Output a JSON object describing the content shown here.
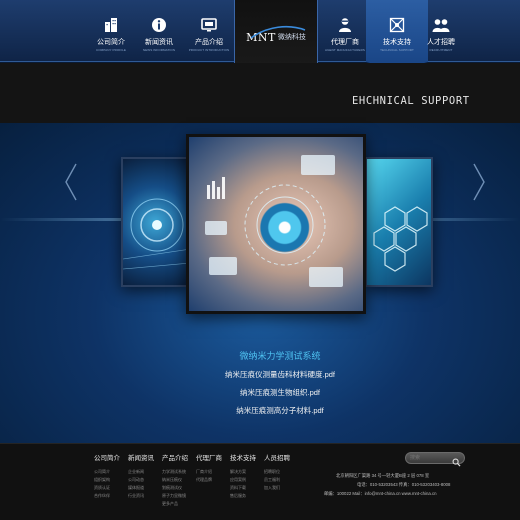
{
  "nav": {
    "items": [
      {
        "label": "公司简介",
        "sub": "COMPANY PROFILE",
        "icon": "building-icon"
      },
      {
        "label": "新闻资讯",
        "sub": "NEWS INFORMATION",
        "icon": "info-icon"
      },
      {
        "label": "产品介绍",
        "sub": "PRODUCT INTRODUCTION",
        "icon": "monitor-icon"
      },
      {
        "label": "代理厂商",
        "sub": "AGENT MANUFACTURERS",
        "icon": "agent-icon"
      },
      {
        "label": "技术支持",
        "sub": "TECHNICAL SUPPORT",
        "icon": "network-icon"
      },
      {
        "label": "人才招聘",
        "sub": "RECRUITMENT",
        "icon": "people-icon"
      }
    ],
    "active_index": 4
  },
  "logo": {
    "text": "MNT",
    "cn": "微纳科技"
  },
  "section_title": "EHCHNICAL SUPPORT",
  "gallery": {
    "caption_title": "微纳米力学测试系统",
    "files": [
      "纳米压痕仪测量齿科材料硬度.pdf",
      "纳米压痕测生物组织.pdf",
      "纳米压痕测高分子材料.pdf"
    ]
  },
  "footer": {
    "columns": [
      {
        "title": "公司简介",
        "links": [
          "公司简介",
          "组织架构",
          "资质认证",
          "合作伙伴"
        ]
      },
      {
        "title": "新闻资讯",
        "links": [
          "企业新闻",
          "公司动态",
          "媒体报道",
          "行业资讯"
        ]
      },
      {
        "title": "产品介绍",
        "links": [
          "力学测试系统",
          "纳米压痕仪",
          "划痕测试仪",
          "原子力显微镜",
          "更多产品"
        ]
      },
      {
        "title": "代理厂商",
        "links": [
          "厂商介绍",
          "代理品牌"
        ]
      },
      {
        "title": "技术支持",
        "links": [
          "解决方案",
          "应用案例",
          "资料下载",
          "售后服务"
        ]
      },
      {
        "title": "人员招聘",
        "links": [
          "招聘职位",
          "员工福利",
          "加入我们"
        ]
      }
    ],
    "search_placeholder": "搜索",
    "address": "北京朝阳区广渠路 34 号一轻大厦B座 2 层 078 室",
    "phone": "电话：010-53203543  传真：010-53203403-8008",
    "email": "邮编：100022  Mail：info@mnt-china.cn  www.mnt-china.cn"
  }
}
